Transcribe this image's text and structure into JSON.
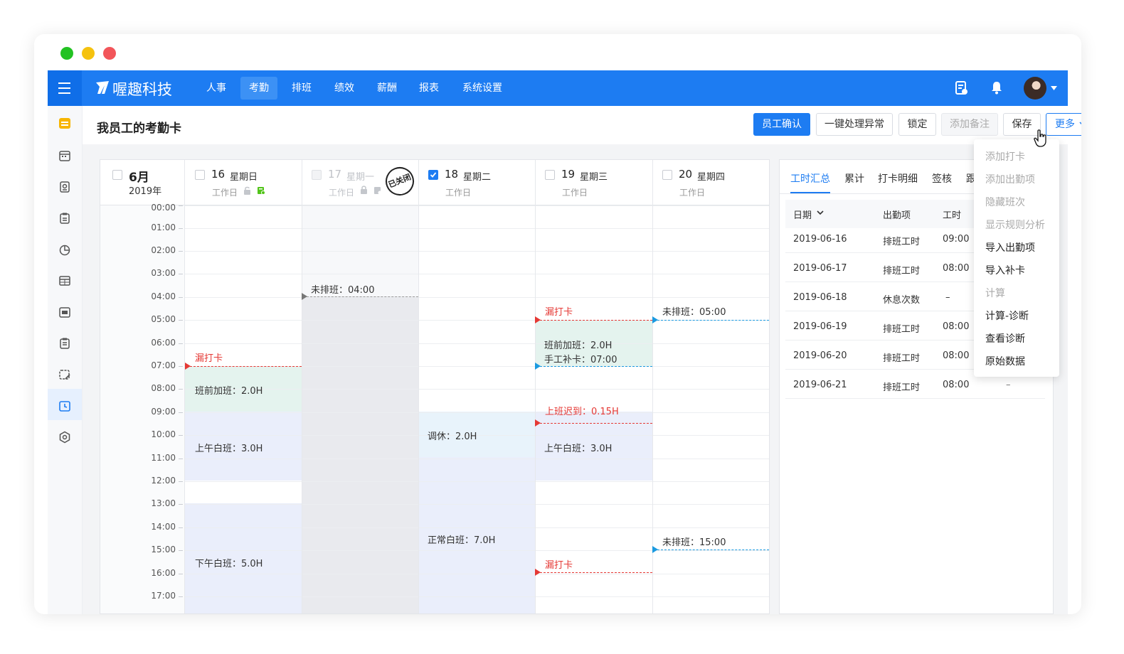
{
  "colors": {
    "brand": "#1d7cf2",
    "danger": "#e53935",
    "info": "#1b9ae0"
  },
  "window": {
    "traffic_lights": [
      "#22c222",
      "#f5c20f",
      "#f2555a"
    ]
  },
  "topbar": {
    "logo": "喔趣科技",
    "nav": [
      {
        "label": "人事"
      },
      {
        "label": "考勤",
        "active": true
      },
      {
        "label": "排班"
      },
      {
        "label": "绩效"
      },
      {
        "label": "薪酬"
      },
      {
        "label": "报表"
      },
      {
        "label": "系统设置"
      }
    ],
    "icons": [
      "doc-icon",
      "bell-icon",
      "avatar",
      "caret-down-icon"
    ]
  },
  "sidebar": {
    "icons": [
      "attendance-calendar-icon",
      "calendar-icon",
      "id-card-icon",
      "clipboard-icon",
      "pie-chart-icon",
      "table-icon",
      "schedule-icon",
      "checklist-icon",
      "calendar-edit-icon",
      "timecard-icon",
      "settings-icon"
    ],
    "active_index": 9
  },
  "header": {
    "title": "我员工的考勤卡",
    "buttons": {
      "confirm": "员工确认",
      "fix": "一键处理异常",
      "lock": "锁定",
      "note": "添加备注",
      "save": "保存",
      "more": "更多"
    }
  },
  "calendar": {
    "month": "6月",
    "year": "2019年",
    "days": [
      {
        "num": "16",
        "weekday": "星期日",
        "type": "工作日",
        "checked": false
      },
      {
        "num": "17",
        "weekday": "星期一",
        "type": "工作日",
        "checked": false,
        "disabled": true,
        "stamp": "已关闭"
      },
      {
        "num": "18",
        "weekday": "星期二",
        "type": "工作日",
        "checked": true
      },
      {
        "num": "19",
        "weekday": "星期三",
        "type": "工作日",
        "checked": false
      },
      {
        "num": "20",
        "weekday": "星期四",
        "type": "工作日",
        "checked": false
      }
    ],
    "hours": [
      "00:00",
      "01:00",
      "02:00",
      "03:00",
      "04:00",
      "05:00",
      "06:00",
      "07:00",
      "08:00",
      "09:00",
      "10:00",
      "11:00",
      "12:00",
      "13:00",
      "14:00",
      "15:00",
      "16:00",
      "17:00"
    ],
    "events": {
      "d16_missed": "漏打卡",
      "d16_ot": "班前加班：2.0H",
      "d16_am": "上午白班：3.0H",
      "d16_pm": "下午白班：5.0H",
      "d17_unscheduled": "未排班：04:00",
      "d18_rest": "调休：2.0H",
      "d18_normal": "正常白班：7.0H",
      "d19_missed1": "漏打卡",
      "d19_ot": "班前加班：2.0H",
      "d19_manual": "手工补卡：07:00",
      "d19_late": "上班迟到：0.15H",
      "d19_am": "上午白班：3.0H",
      "d19_missed2": "漏打卡",
      "d20_unscheduled1": "未排班：05:00",
      "d20_unscheduled2": "未排班：15:00"
    }
  },
  "summary": {
    "tabs": [
      "工时汇总",
      "累计",
      "打卡明细",
      "签核",
      "跟"
    ],
    "active_tab": 0,
    "headers": [
      "日期",
      "出勤项",
      "工时"
    ],
    "rows": [
      {
        "date": "2019-06-16",
        "item": "排班工时",
        "hours": "09:00"
      },
      {
        "date": "2019-06-17",
        "item": "排班工时",
        "hours": "08:00"
      },
      {
        "date": "2019-06-18",
        "item": "休息次数",
        "hours": "–"
      },
      {
        "date": "2019-06-19",
        "item": "排班工时",
        "hours": "08:00"
      },
      {
        "date": "2019-06-20",
        "item": "排班工时",
        "hours": "08:00"
      },
      {
        "date": "2019-06-21",
        "item": "排班工时",
        "hours": "08:00",
        "extra": "–"
      }
    ]
  },
  "more_menu": {
    "items": [
      {
        "label": "添加打卡",
        "enabled": false
      },
      {
        "label": "添加出勤项",
        "enabled": false
      },
      {
        "label": "隐藏班次",
        "enabled": false
      },
      {
        "label": "显示规则分析",
        "enabled": false
      },
      {
        "label": "导入出勤项",
        "enabled": true
      },
      {
        "label": "导入补卡",
        "enabled": true
      },
      {
        "label": "计算",
        "enabled": false
      },
      {
        "label": "计算-诊断",
        "enabled": true
      },
      {
        "label": "查看诊断",
        "enabled": true
      },
      {
        "label": "原始数据",
        "enabled": true
      }
    ]
  }
}
